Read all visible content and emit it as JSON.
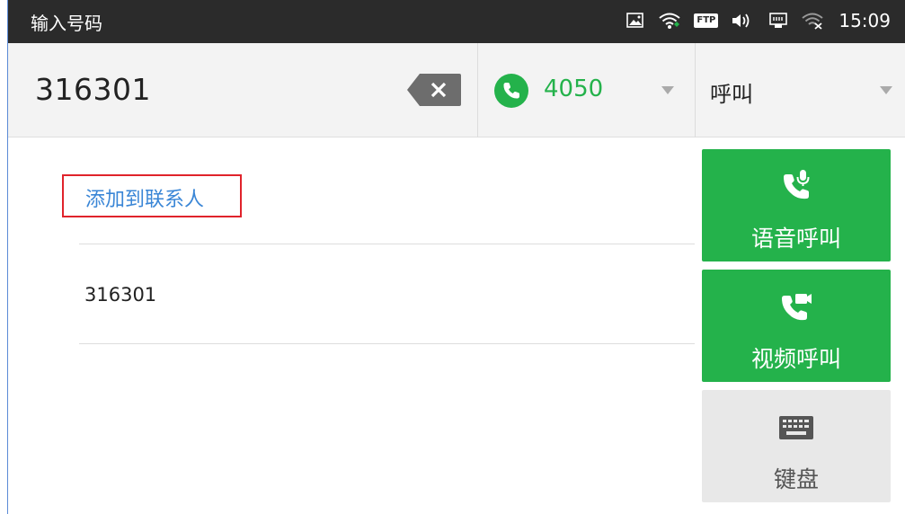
{
  "status_bar": {
    "title": "输入号码",
    "ftp_badge": "FTP",
    "time": "15:09"
  },
  "dial": {
    "number": "316301",
    "account": "4050",
    "call_type": "呼叫"
  },
  "content": {
    "add_contact": "添加到联系人",
    "results": [
      "316301"
    ]
  },
  "actions": {
    "voice_call": "语音呼叫",
    "video_call": "视频呼叫",
    "keypad": "键盘"
  },
  "colors": {
    "accent_green": "#24b24b",
    "link_blue": "#3a86d6",
    "highlight_red": "#e0232b",
    "status_bar": "#2b2b2b"
  },
  "icons": {
    "status": [
      "screenshot-icon",
      "wifi-icon",
      "ftp-icon",
      "volume-icon",
      "ethernet-icon",
      "wifi-off-icon"
    ],
    "backspace": "backspace-icon",
    "account": "phone-icon",
    "voice": "voice-call-icon",
    "video": "video-call-icon",
    "keypad": "keyboard-icon"
  }
}
